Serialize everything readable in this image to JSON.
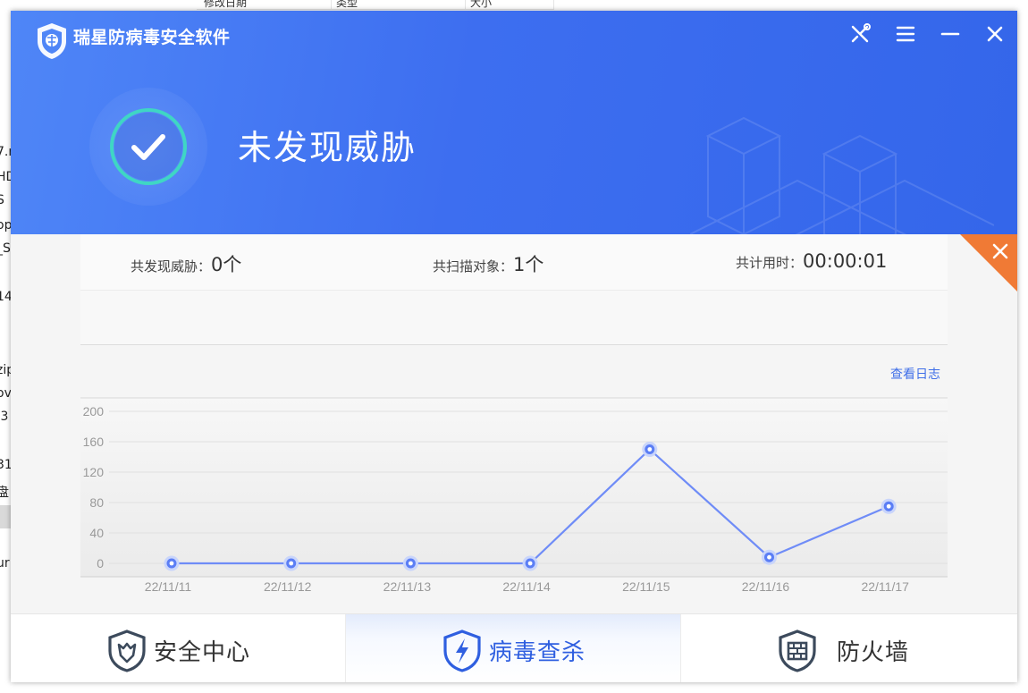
{
  "background": {
    "columns": [
      "修改日期",
      "类型",
      "大小"
    ],
    "side_fragments": [
      "7.r",
      "HD",
      "S",
      "op",
      "_S",
      "14",
      "zip",
      "ov",
      ".3",
      "31",
      "盘",
      "ur"
    ]
  },
  "window": {
    "title": "瑞星防病毒安全软件",
    "status": "未发现威胁",
    "titlebar_buttons": [
      "tools-icon",
      "menu-icon",
      "minimize-icon",
      "close-icon"
    ]
  },
  "stats": {
    "threats_label": "共发现威胁：",
    "threats_value": "0个",
    "scanned_label": "共扫描对象：",
    "scanned_value": "1个",
    "time_label": "共计用时：",
    "time_value": "00:00:01"
  },
  "log_link": "查看日志",
  "chart_data": {
    "type": "line",
    "categories": [
      "22/11/11",
      "22/11/12",
      "22/11/13",
      "22/11/14",
      "22/11/15",
      "22/11/16",
      "22/11/17"
    ],
    "values": [
      0,
      0,
      0,
      0,
      150,
      8,
      75
    ],
    "yticks": [
      0,
      40,
      80,
      120,
      160,
      200
    ],
    "ylim": [
      0,
      200
    ],
    "grid": true,
    "line_color": "#6f8cf7"
  },
  "tabs": [
    {
      "label": "安全中心",
      "icon": "shield-lion-icon"
    },
    {
      "label": "病毒查杀",
      "icon": "shield-lightning-icon",
      "active": true
    },
    {
      "label": "防火墙",
      "icon": "shield-firewall-icon"
    }
  ],
  "colors": {
    "header_blue": "#3d6ef0",
    "accent_orange": "#f07a35",
    "ring_teal": "#3fd6c4",
    "link_blue": "#3f6ee8"
  }
}
